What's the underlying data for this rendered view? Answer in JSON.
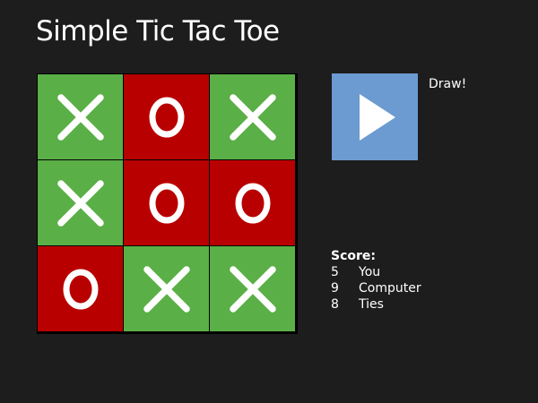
{
  "app": {
    "title": "Simple Tic Tac Toe"
  },
  "board": {
    "cells": [
      "X",
      "O",
      "X",
      "X",
      "O",
      "O",
      "O",
      "X",
      "X"
    ]
  },
  "status": {
    "message": "Draw!"
  },
  "play_button": {
    "icon": "play-icon"
  },
  "score": {
    "heading": "Score:",
    "rows": [
      {
        "value": "5",
        "label": "You"
      },
      {
        "value": "9",
        "label": "Computer"
      },
      {
        "value": "8",
        "label": "Ties"
      }
    ]
  },
  "colors": {
    "background": "#1d1d1d",
    "x_cell": "#5aaf47",
    "o_cell": "#b80000",
    "play_button": "#6b9bd0"
  }
}
